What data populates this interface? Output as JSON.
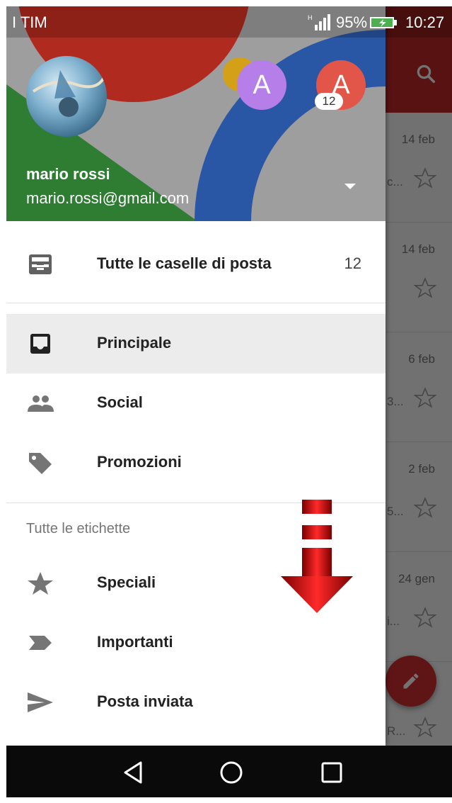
{
  "status_bar": {
    "carrier": "I TIM",
    "battery": "95%",
    "time": "10:27",
    "signal_icon": "signal-icon",
    "battery_icon": "battery-charging-icon"
  },
  "background_app": {
    "search_icon": "search-icon",
    "rows": [
      {
        "date": "14 feb",
        "snippet": "c..."
      },
      {
        "date": "14 feb",
        "snippet": ""
      },
      {
        "date": "6 feb",
        "snippet": "3..."
      },
      {
        "date": "2 feb",
        "snippet": "5..."
      },
      {
        "date": "24 gen",
        "snippet": "i..."
      },
      {
        "date": "",
        "snippet": "R..."
      }
    ],
    "compose_icon": "pencil-icon",
    "accent": "#c62828"
  },
  "account": {
    "name": "mario rossi",
    "email": "mario.rossi@gmail.com",
    "other_accounts": [
      {
        "initial": "A",
        "color": "#b57ee8"
      },
      {
        "initial": "A",
        "color": "#e2564a",
        "badge": "12"
      }
    ]
  },
  "drawer": {
    "all_inboxes": {
      "label": "Tutte le caselle di posta",
      "count": "12",
      "icon": "all-inboxes-icon"
    },
    "categories": [
      {
        "label": "Principale",
        "icon": "inbox-icon",
        "selected": true
      },
      {
        "label": "Social",
        "icon": "people-icon",
        "selected": false
      },
      {
        "label": "Promozioni",
        "icon": "tag-icon",
        "selected": false
      }
    ],
    "section_title": "Tutte le etichette",
    "labels": [
      {
        "label": "Speciali",
        "icon": "star-icon"
      },
      {
        "label": "Importanti",
        "icon": "important-icon"
      },
      {
        "label": "Posta inviata",
        "icon": "send-icon"
      }
    ]
  },
  "navigation": {
    "back": "back-icon",
    "home": "home-icon",
    "recents": "recents-icon"
  }
}
